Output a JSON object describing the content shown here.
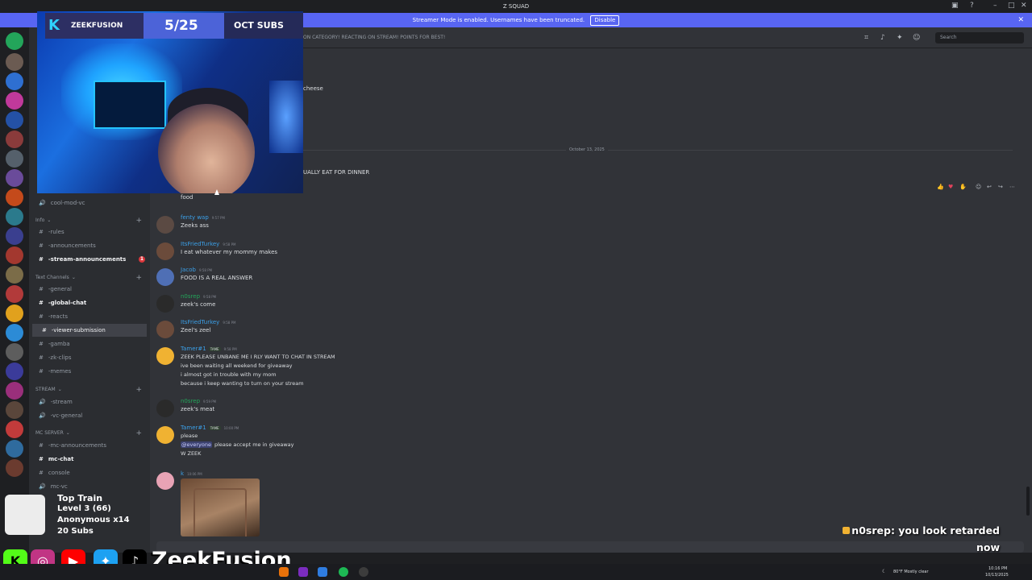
{
  "window": {
    "title": "Z SQUAD"
  },
  "banner": {
    "text": "Streamer Mode is enabled. Usernames have been truncated.",
    "disable_label": "Disable",
    "close": "✕"
  },
  "topbar": {
    "topic": "ON CATEGORY! REACTING ON STREAM! POINTS FOR BEST!",
    "search_placeholder": "Search"
  },
  "sidebar": {
    "items": [
      {
        "label": "cool-mod-vc",
        "icon": "🔊"
      },
      {
        "label": "Info",
        "icon": "⌄",
        "type": "category"
      },
      {
        "label": "-rules",
        "icon": "#"
      },
      {
        "label": "-announcements",
        "icon": "#"
      },
      {
        "label": "-stream-announcements",
        "icon": "#",
        "badge": "1"
      },
      {
        "label": "Text Channels",
        "icon": "⌄",
        "type": "category"
      },
      {
        "label": "-general",
        "icon": "#"
      },
      {
        "label": "-global-chat",
        "icon": "#"
      },
      {
        "label": "-reacts",
        "icon": "#"
      },
      {
        "label": "-viewer-submission",
        "icon": "#"
      },
      {
        "label": "-gamba",
        "icon": "#"
      },
      {
        "label": "-zk-clips",
        "icon": "#"
      },
      {
        "label": "-memes",
        "icon": "#"
      },
      {
        "label": "STREAM",
        "icon": "⌄",
        "type": "category"
      },
      {
        "label": "-stream",
        "icon": "🔊"
      },
      {
        "label": "-vc-general",
        "icon": "🔊"
      },
      {
        "label": "MC SERVER",
        "icon": "⌄",
        "type": "category"
      },
      {
        "label": "-mc-announcements",
        "icon": "#"
      },
      {
        "label": "mc-chat",
        "icon": "#"
      },
      {
        "label": "console",
        "icon": "#"
      },
      {
        "label": "mc-vc",
        "icon": "🔊"
      }
    ]
  },
  "partial": {
    "cheese": "cheese",
    "dinner": "UALLY EAT FOR DINNER"
  },
  "day_divider": "October 13, 2025",
  "messages": [
    {
      "user": "",
      "time": "",
      "lines": [
        "food"
      ]
    },
    {
      "user": "fenty wap",
      "time": "9:57 PM",
      "lines": [
        "Zeeks ass"
      ]
    },
    {
      "user": "ItsFriedTurkey",
      "time": "9:58 PM",
      "lines": [
        "I eat whatever my mommy makes"
      ]
    },
    {
      "user": "Jacob",
      "time": "9:58 PM",
      "lines": [
        "FOOD IS A REAL ANSWER"
      ]
    },
    {
      "user": "n0srep",
      "time": "9:58 PM",
      "lines": [
        "zeek's come"
      ]
    },
    {
      "user": "ItsFriedTurkey",
      "time": "9:58 PM",
      "lines": [
        "Zeel's zeel"
      ]
    },
    {
      "user": "Tamer#1",
      "time": "9:58 PM",
      "tag": "TAME",
      "lines": [
        "ZEEK PLEASE UNBANE ME I RLY WANT TO CHAT IN STREAM",
        "ive been waiting all weekend for giveaway",
        "i almost got in trouble with my mom",
        "because i keep wanting to turn on your stream"
      ]
    },
    {
      "user": "n0srep",
      "time": "9:59 PM",
      "lines": [
        "zeek's meat"
      ]
    },
    {
      "user": "Tamer#1",
      "time": "10:00 PM",
      "tag": "TAME",
      "lines": [
        "please",
        "please accept me in giveaway",
        "W ZEEK"
      ],
      "mention": "@everyone"
    },
    {
      "user": "k",
      "time": "10:06 PM",
      "lines": []
    }
  ],
  "overlay": {
    "channel": "ZEEKFUSION",
    "sub_count": "5/25",
    "sub_label": "OCT SUBS"
  },
  "train": {
    "title": "Top Train",
    "level": "Level 3 (66)",
    "anon": "Anonymous x14",
    "subs": "20 Subs"
  },
  "socials": {
    "brand": "ZeekFusion"
  },
  "alert": {
    "user": "n0srep",
    "message": ": you look retarded now"
  },
  "taskbar": {
    "weather": "80°F Mostly clear",
    "time": "10:16 PM",
    "date": "10/13/2025"
  }
}
